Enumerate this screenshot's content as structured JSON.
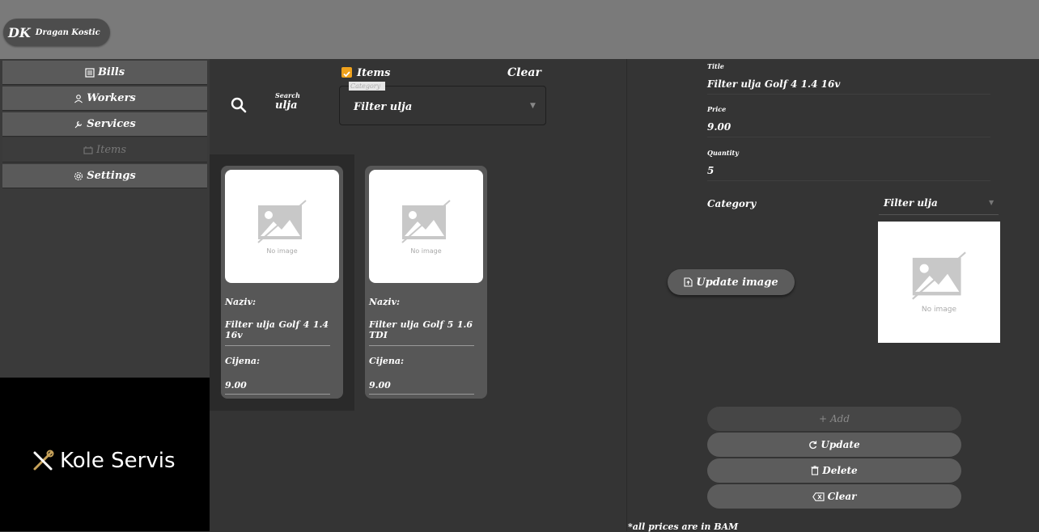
{
  "user": {
    "initials": "DK",
    "name": "Dragan Kostic"
  },
  "sidebar": {
    "items": [
      {
        "label": "Bills",
        "icon": "receipt-icon"
      },
      {
        "label": "Workers",
        "icon": "worker-icon"
      },
      {
        "label": "Services",
        "icon": "wrench-icon"
      },
      {
        "label": "Items",
        "icon": "items-icon",
        "disabled": true
      },
      {
        "label": "Settings",
        "icon": "gear-icon"
      }
    ]
  },
  "logo": {
    "text": "Kole Servis"
  },
  "search": {
    "label": "Search",
    "value": "ulja"
  },
  "filter": {
    "items_label": "Items",
    "items_checked": true,
    "clear_label": "Clear",
    "category_legend": "Category",
    "category_value": "Filter ulja"
  },
  "cards": [
    {
      "name_label": "Naziv:",
      "name": "Filter ulja Golf 4 1.4 16v",
      "price_label": "Cijena:",
      "price": "9.00",
      "image_text": "No image"
    },
    {
      "name_label": "Naziv:",
      "name": "Filter ulja Golf 5 1.6 TDI",
      "price_label": "Cijena:",
      "price": "9.00",
      "image_text": "No image"
    }
  ],
  "form": {
    "title_label": "Title",
    "title_value": "Filter ulja Golf 4 1.4 16v",
    "price_label": "Price",
    "price_value": "9.00",
    "quantity_label": "Quantity",
    "quantity_value": "5",
    "category_label": "Category",
    "category_value": "Filter ulja",
    "image_text": "No image",
    "update_image": "Update image"
  },
  "actions": {
    "add": "Add",
    "update": "Update",
    "delete": "Delete",
    "clear": "Clear"
  },
  "footnote": "*all prices are in BAM",
  "colors": {
    "accent": "#f0a21c",
    "topbar": "#7a7a7a",
    "background": "#343434"
  }
}
